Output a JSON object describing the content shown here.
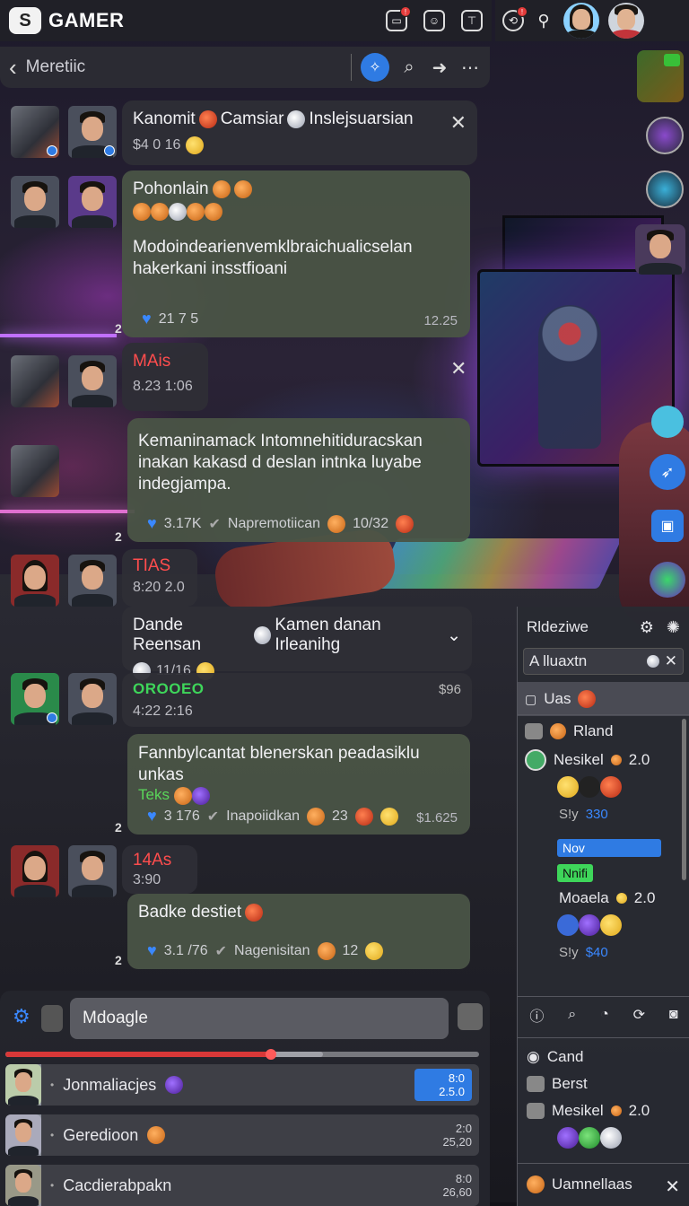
{
  "app": {
    "brand": "GAMER",
    "breadcrumb": "Meretiic"
  },
  "colors": {
    "accent": "#2f7be3",
    "alert": "#e43b3b",
    "green_tag": "#3ed65a"
  },
  "messages": [
    {
      "title_a": "Kanomit",
      "title_b": "Camsiar",
      "title_c": "Inslejsuarsian",
      "meta": "$4 0 16"
    },
    {
      "title": "Pohonlain",
      "body": "Modoindearienvemklbraichualicselan hakerkani insstfioani",
      "likes": "21 7 5",
      "time": "12.25",
      "side": "2"
    },
    {
      "title": "MAis",
      "meta": "8.23  1:06"
    },
    {
      "body": "Kemaninamack  Intomnehitiduracskan inakan kakasd d deslan intnka luyabe indegjampa.",
      "likes": "3.17K",
      "tag": "Napremotiican",
      "count": "10/32",
      "side": "2"
    },
    {
      "title": "TIAS",
      "meta": "8:20  2.0"
    },
    {
      "title_a": "Dande Reensan",
      "title_b": "Kamen danan Irleanihg",
      "meta": "11/16"
    },
    {
      "title": "OROOEO",
      "meta": "4:22  2:16",
      "right": "$96"
    },
    {
      "body": "Fannbylcantat blenerskan peadasiklu unkas",
      "tag_green": "Teks",
      "likes": "3 176",
      "tag": "Inapoiidkan",
      "count": "23",
      "time": "$1.625",
      "side": "2"
    },
    {
      "title": "14As",
      "meta": "3:90"
    },
    {
      "body": "Badke destiet",
      "likes": "3.1 /76",
      "tag": "Nagenisitan",
      "count": "12",
      "side": "2"
    }
  ],
  "right_panel": {
    "header": "Rldeziwe",
    "search_value": "A lluaxtn",
    "tab": "Uas",
    "items": [
      {
        "name": "Rland"
      },
      {
        "name": "Nesikel",
        "value": "2.0"
      },
      {
        "label": "S!y",
        "price": "330"
      },
      {
        "pill": "Nov"
      },
      {
        "pill": "Nnifi"
      },
      {
        "name": "Moaela",
        "value": "2.0"
      },
      {
        "label": "S!y",
        "price": "$40"
      }
    ],
    "bottom": [
      {
        "name": "Cand"
      },
      {
        "name": "Berst"
      },
      {
        "name": "Mesikel",
        "value": "2.0"
      }
    ],
    "footer": "Uamnellaas"
  },
  "composer": {
    "placeholder": "Mdoagle",
    "progress": 0.56,
    "buffer": 0.67,
    "rows": [
      {
        "name": "Jonmaliacjes",
        "value_top": "8:0",
        "value_bottom": "2.5.0"
      },
      {
        "name": "Geredioon",
        "value_top": "2:0",
        "value_bottom": "25,20"
      },
      {
        "name": "Cacdierabpakn",
        "value_top": "8:0",
        "value_bottom": "26,60"
      }
    ]
  }
}
